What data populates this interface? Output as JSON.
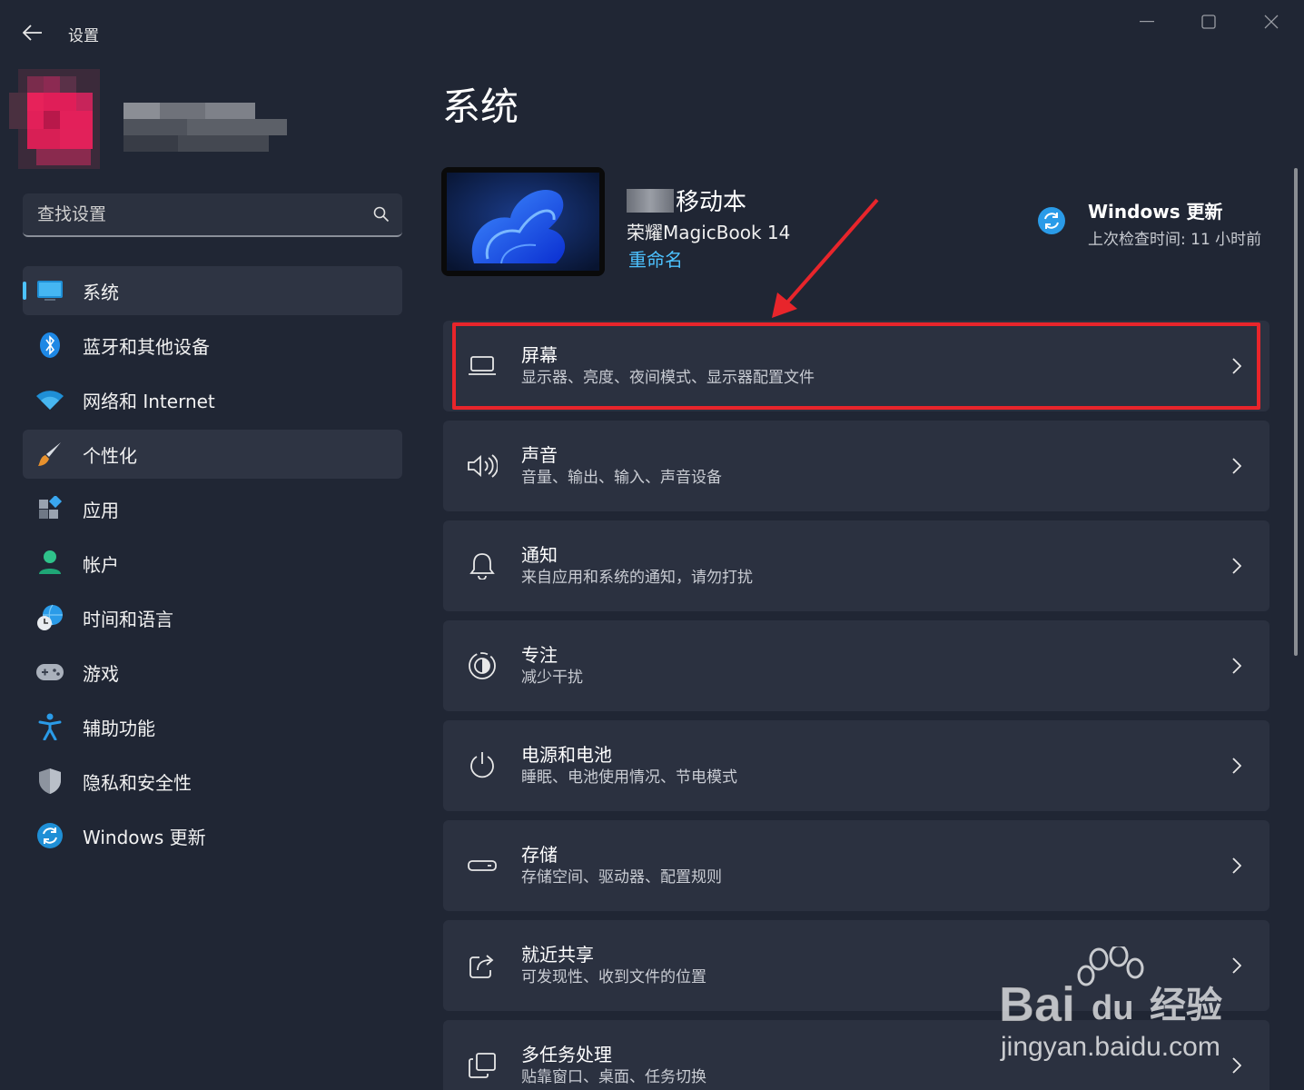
{
  "window": {
    "app_title": "设置",
    "back_icon": "arrow-left-icon",
    "minimize_icon": "minimize-icon",
    "maximize_icon": "maximize-icon",
    "close_icon": "close-icon"
  },
  "search": {
    "placeholder": "查找设置",
    "icon": "search-icon"
  },
  "sidebar": {
    "items": [
      {
        "label": "系统",
        "icon": "monitor-icon",
        "active": true
      },
      {
        "label": "蓝牙和其他设备",
        "icon": "bluetooth-icon"
      },
      {
        "label": "网络和 Internet",
        "icon": "wifi-icon"
      },
      {
        "label": "个性化",
        "icon": "paintbrush-icon",
        "hovered": true
      },
      {
        "label": "应用",
        "icon": "apps-icon"
      },
      {
        "label": "帐户",
        "icon": "person-icon"
      },
      {
        "label": "时间和语言",
        "icon": "globe-clock-icon"
      },
      {
        "label": "游戏",
        "icon": "gamepad-icon"
      },
      {
        "label": "辅助功能",
        "icon": "accessibility-icon"
      },
      {
        "label": "隐私和安全性",
        "icon": "shield-icon"
      },
      {
        "label": "Windows 更新",
        "icon": "sync-icon"
      }
    ]
  },
  "main": {
    "title": "系统",
    "device": {
      "name_suffix": "移动本",
      "model": "荣耀MagicBook 14",
      "rename": "重命名"
    },
    "update": {
      "title": "Windows 更新",
      "subtitle": "上次检查时间: 11 小时前"
    },
    "cards": [
      {
        "title": "屏幕",
        "desc": "显示器、亮度、夜间模式、显示器配置文件",
        "icon": "laptop-icon",
        "highlighted": true
      },
      {
        "title": "声音",
        "desc": "音量、输出、输入、声音设备",
        "icon": "speaker-icon"
      },
      {
        "title": "通知",
        "desc": "来自应用和系统的通知，请勿打扰",
        "icon": "bell-icon"
      },
      {
        "title": "专注",
        "desc": "减少干扰",
        "icon": "focus-icon"
      },
      {
        "title": "电源和电池",
        "desc": "睡眠、电池使用情况、节电模式",
        "icon": "power-icon"
      },
      {
        "title": "存储",
        "desc": "存储空间、驱动器、配置规则",
        "icon": "drive-icon"
      },
      {
        "title": "就近共享",
        "desc": "可发现性、收到文件的位置",
        "icon": "share-icon"
      },
      {
        "title": "多任务处理",
        "desc": "贴靠窗口、桌面、任务切换",
        "icon": "multitask-icon"
      }
    ]
  },
  "colors": {
    "accent": "#4cc2ff",
    "highlight": "#e8252b",
    "background": "#202634",
    "card": "#2b3140"
  },
  "watermark": {
    "brand": "Bai",
    "brand_suffix": "du",
    "label": "经验",
    "url": "jingyan.baidu.com"
  }
}
